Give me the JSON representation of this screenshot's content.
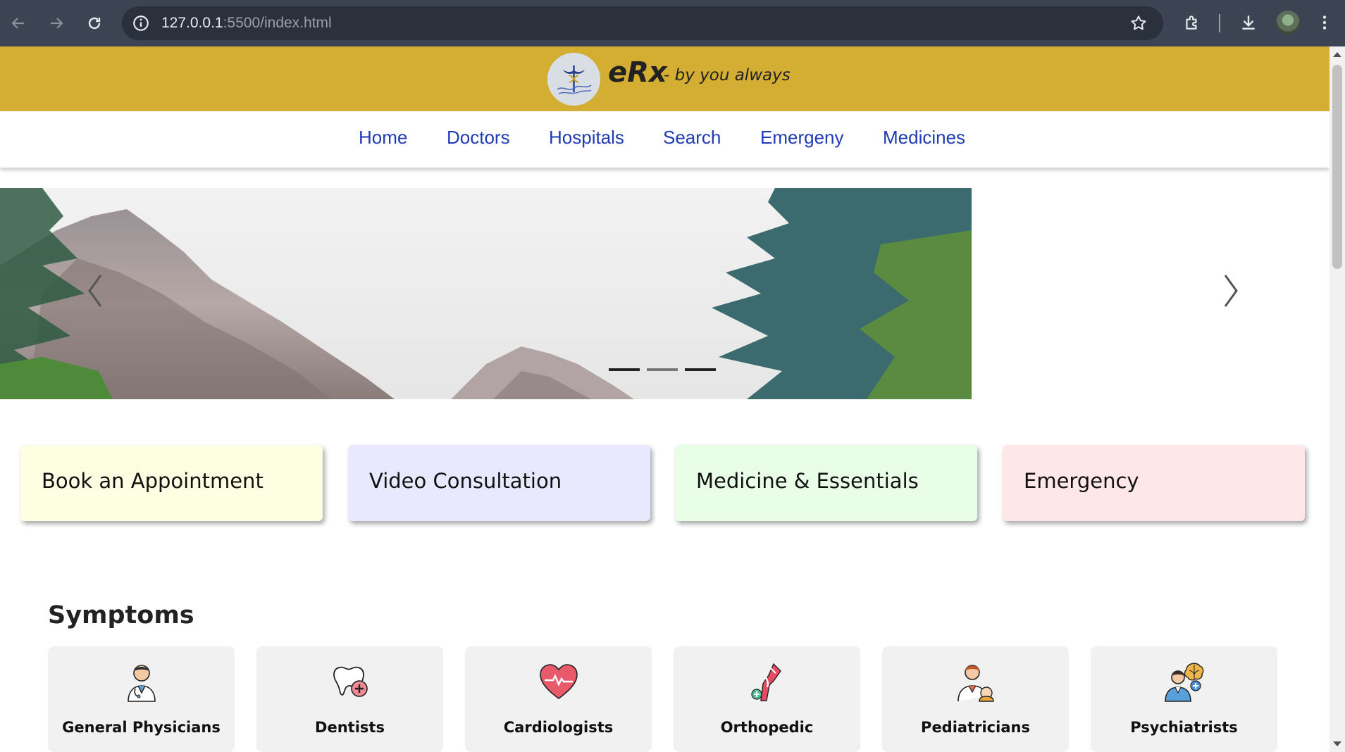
{
  "browser": {
    "url_host": "127.0.0.1",
    "url_rest": ":5500/index.html"
  },
  "header": {
    "brand": "eRx",
    "tagline": "- by you always"
  },
  "nav": [
    "Home",
    "Doctors",
    "Hospitals",
    "Search",
    "Emergeny",
    "Medicines"
  ],
  "carousel": {
    "slide_count": 3,
    "active_index": 1
  },
  "services": [
    {
      "label": "Book an Appointment",
      "color": "#fefee2"
    },
    {
      "label": "Video Consultation",
      "color": "#e8e9fe"
    },
    {
      "label": "Medicine & Essentials",
      "color": "#e8fee6"
    },
    {
      "label": "Emergency",
      "color": "#ffe6e8"
    }
  ],
  "symptoms": {
    "title": "Symptoms",
    "items": [
      {
        "label": "General Physicians",
        "icon": "doctor-icon"
      },
      {
        "label": "Dentists",
        "icon": "tooth-icon"
      },
      {
        "label": "Cardiologists",
        "icon": "heart-icon"
      },
      {
        "label": "Orthopedic",
        "icon": "bone-joint-icon"
      },
      {
        "label": "Pediatricians",
        "icon": "pediatrician-icon"
      },
      {
        "label": "Psychiatrists",
        "icon": "brain-doctor-icon"
      }
    ]
  },
  "colors": {
    "brand_bar": "#d4ad33",
    "nav_link": "#1f3bb5",
    "chrome": "#3c4454"
  }
}
